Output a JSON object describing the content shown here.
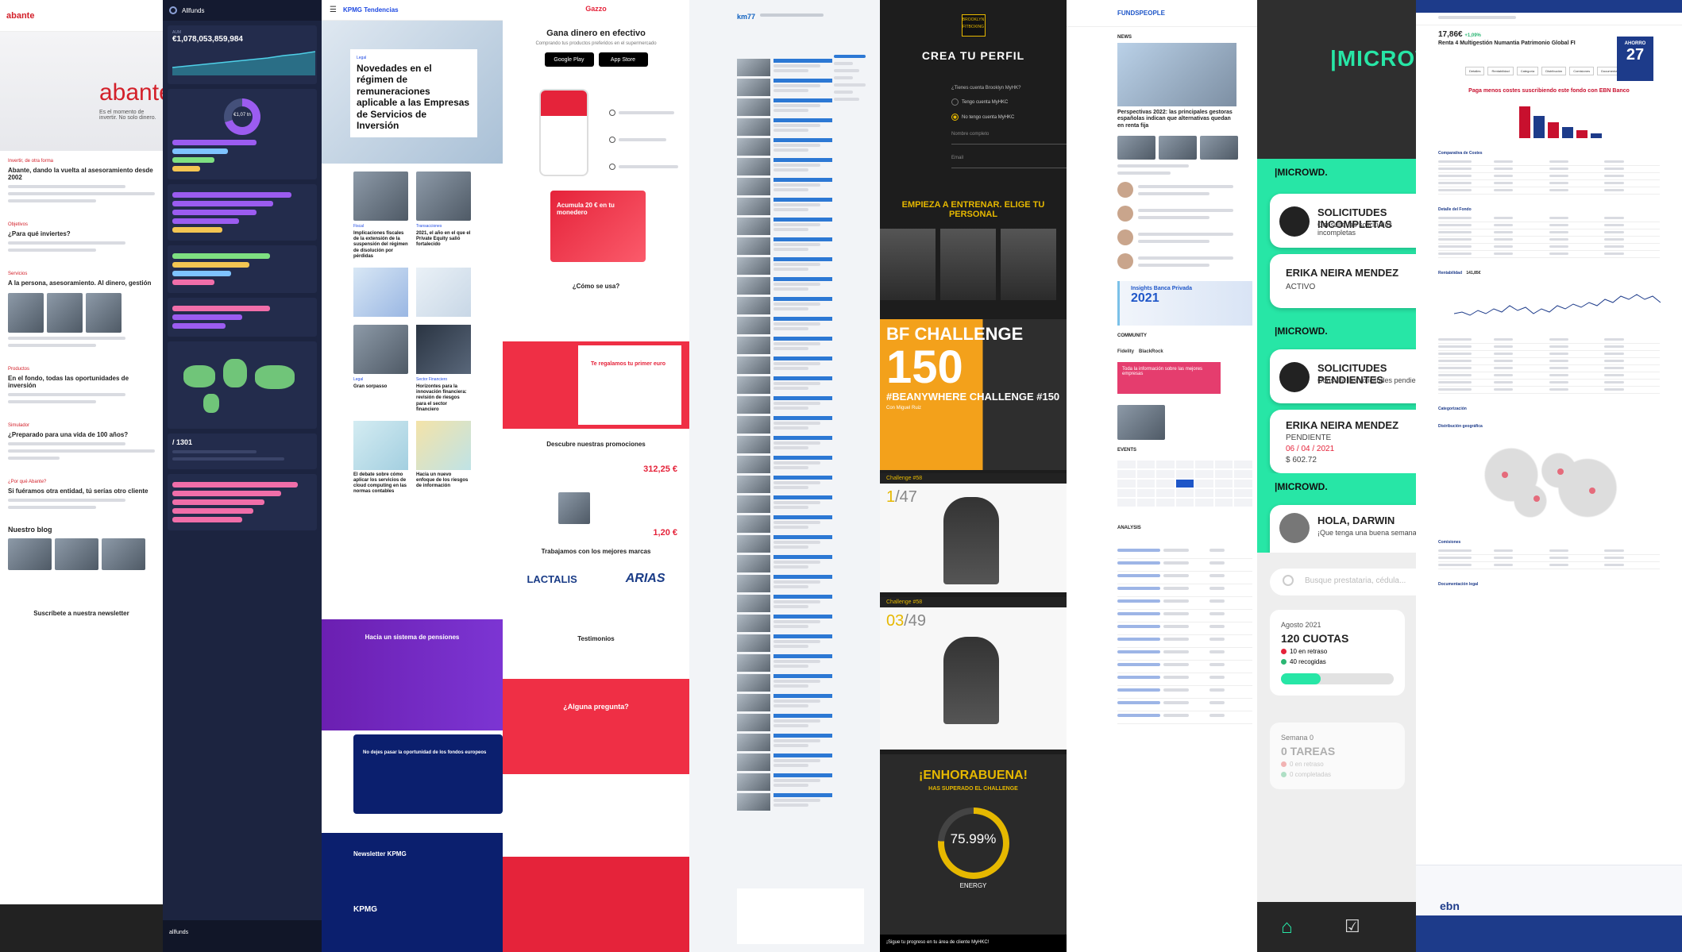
{
  "abante": {
    "logo": "abante",
    "hero_big": "abante",
    "hero_sub": "Es el momento de invertir. No solo dinero.",
    "s1_kicker": "Invertir, de otra forma",
    "s1_title": "Abante, dando la vuelta al asesoramiento desde 2002",
    "s2_kicker": "Objetivos",
    "s2_title": "¿Para qué inviertes?",
    "s3_kicker": "Servicios",
    "s3_title": "A la persona, asesoramiento. Al dinero, gestión",
    "s4_kicker": "Productos",
    "s4_title": "En el fondo, todas las oportunidades de inversión",
    "s5_kicker": "Simulador",
    "s5_title": "¿Preparado para una vida de 100 años?",
    "s6_kicker": "¿Por qué Abante?",
    "s6_title": "Si fuéramos otra entidad, tú serías otro cliente",
    "blog_title": "Nuestro blog",
    "newsletter": "Suscríbete a nuestra newsletter"
  },
  "allfunds": {
    "brand": "Allfunds",
    "aum_label": "AUM",
    "aum_value": "€1,078,053,859,984",
    "donut_value": "€1,07 tn",
    "footer_brand": "allfunds",
    "fx_value": "/ 1301"
  },
  "kpmg": {
    "brand": "KPMG Tendencias",
    "category": "Legal",
    "headline": "Novedades en el régimen de remuneraciones aplicable a las Empresas de Servicios de Inversión",
    "card1_tag": "Fiscal",
    "card1_title": "Implicaciones fiscales de la extensión de la suspensión del régimen de disolución por pérdidas",
    "card2_tag": "Transacciones",
    "card2_title": "2021, el año en el que el Private Equity salió fortalecido",
    "card3_tag": "Legal",
    "card3_title": "Gran sorpasso",
    "card4_tag": "Sector Financiero",
    "card4_title": "Horizontes para la innovación financiera: revisión de riesgos para el sector financiero",
    "card5_title": "El debate sobre cómo aplicar los servicios de cloud computing en las normas contables",
    "card6_title": "Hacia un nuevo enfoque de los riesgos de información",
    "purple_title": "Hacia un sistema de pensiones",
    "navy_title": "No dejes pasar la oportunidad de los fondos europeos",
    "footer_title": "Newsletter KPMG",
    "footer_brand": "KPMG"
  },
  "gazzo": {
    "brand": "Gazzo",
    "title": "Gana dinero en efectivo",
    "sub": "Comprando tus productos preferidos en el supermercado",
    "store1": "Google Play",
    "store2": "App Store",
    "promo": "Acumula 20 € en tu monedero",
    "how": "¿Cómo se usa?",
    "gift": "Te regalamos tu primer euro",
    "promos": "Descubre nuestras promociones",
    "price1": "312,25 €",
    "price2": "1,20 €",
    "brands_title": "Trabajamos con los mejores marcas",
    "brand1": "LACTALIS",
    "brand2": "ARIAS",
    "testimonials": "Testimonios",
    "question": "¿Alguna pregunta?"
  },
  "km77": {
    "brand": "km77"
  },
  "brooklyn": {
    "logo": "BROOKLYN FITBOXING",
    "title": "CREA TU PERFIL",
    "question": "¿Tienes cuenta Brooklyn MyHK?",
    "opt1": "Tengo cuenta MyHKC",
    "opt2": "No tengo cuenta MyHKC",
    "field1": "Nombre completo",
    "field2": "Email",
    "subtitle": "EMPIEZA A ENTRENAR. ELIGE TU PERSONAL",
    "bf_line1": "BF CHALLENGE",
    "bf_number": "150",
    "bf_tag": "#BEANYWHERE CHALLENGE #150",
    "bf_author": "Con Miguel Ruiz",
    "ch1_label": "Challenge #58",
    "ch1_num": "1",
    "ch1_total": "/47",
    "ch2_label": "Challenge #58",
    "ch2_num": "03",
    "ch2_total": "/49",
    "done_title": "¡ENHORABUENA!",
    "done_sub": "HAS SUPERADO EL CHALLENGE",
    "done_value": "75.99%",
    "energy": "ENERGY",
    "footer": "¡Sigue tu progreso en tu área de cliente MyHKC!"
  },
  "fundspeople": {
    "brand": "FUNDSPEOPLE",
    "news": "NEWS",
    "headline": "Perspectivas 2022: las principales gestoras españolas indican que alternativas quedan en renta fija",
    "banner_line": "Insights Banca Privada",
    "banner_year": "2021",
    "community": "COMMUNITY",
    "logo1": "Fidelity",
    "logo2": "BlackRock",
    "pink_text": "Toda la información sobre las mejores empresas",
    "events": "EVENTS",
    "analysis": "ANALYSIS"
  },
  "microwd": {
    "hero_brand": "|MICROWD.",
    "card1_brand": "|MICROWD.",
    "card1_title": "SOLICITUDES INCOMPLETAS",
    "card1_sub": "Consulte las solicitudes incompletas",
    "card1_name": "ERIKA NEIRA MENDEZ",
    "card1_status": "ACTIVO",
    "card2_brand": "|MICROWD.",
    "card2_title": "SOLICITUDES PENDIENTES",
    "card2_sub": "Consulta las solicitudes pendientes",
    "card2_name": "ERIKA NEIRA MENDEZ",
    "card2_status": "PENDIENTE",
    "card2_date": "06 / 04 / 2021",
    "card2_amount": "$ 602.72",
    "card3_brand": "|MICROWD.",
    "card3_title": "HOLA, DARWIN",
    "card3_sub": "¡Que tenga una buena semana!",
    "search_placeholder": "Busque prestataria, cédula...",
    "tile1_month": "Agosto 2021",
    "tile1_count": "120 CUOTAS",
    "tile1_d1": "10 en retraso",
    "tile1_d2": "40 recogidas",
    "tile2_month": "Semana 0",
    "tile2_count": "0 TAREAS",
    "tile2_d1": "0 en retraso",
    "tile2_d2": "0 completadas",
    "accent": "#27e6a6"
  },
  "ebn": {
    "price": "17,86€",
    "change": "+1,09%",
    "fund_name": "Renta 4 Multigestión Numantia Patrimonio Global FI",
    "ahorro_label": "AHORRO",
    "ahorro_value": "27",
    "highlight": "Paga menos costes suscribiendo este fondo con EBN Banco",
    "tab1": "Detalles",
    "tab2": "Rentabilidad",
    "tab3": "Categoría",
    "tab4": "Distribución",
    "tab5": "Comisiones",
    "tab6": "Documentación",
    "sec_costs": "Comparativa de Costes",
    "sec_detail": "Detalle del Fondo",
    "sec_rent": "Rentabilidad",
    "rent_value": "141,85€",
    "sec_cat": "Categorización",
    "sec_geo": "Distribución geográfica",
    "sec_com": "Comisiones",
    "sec_doc": "Documentación legal",
    "logo": "ebn",
    "brand_color": "#1d3b8a"
  }
}
